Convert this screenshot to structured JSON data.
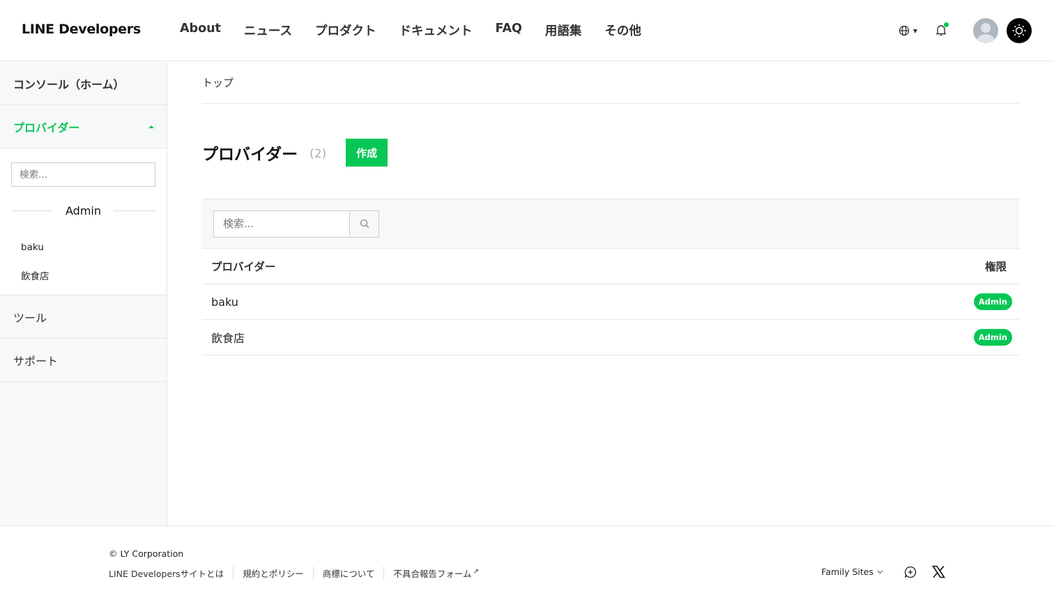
{
  "header": {
    "logo": "LINE Developers",
    "nav": [
      "About",
      "ニュース",
      "プロダクト",
      "ドキュメント",
      "FAQ",
      "用語集",
      "その他"
    ],
    "icons": [
      "globe-icon",
      "bell-icon",
      "avatar",
      "sun-icon"
    ]
  },
  "sidebar": {
    "console": "コンソール（ホーム）",
    "providers": "プロバイダー",
    "search_placeholder": "検索...",
    "group_label": "Admin",
    "provider_items": [
      "baku",
      "飲食店"
    ],
    "tools": "ツール",
    "support": "サポート"
  },
  "main": {
    "breadcrumb": "トップ",
    "title": "プロバイダー",
    "count": "(2)",
    "create_label": "作成",
    "search_placeholder": "検索...",
    "table": {
      "headers": [
        "プロバイダー",
        "権限"
      ],
      "rows": [
        {
          "name": "baku",
          "role": "Admin"
        },
        {
          "name": "飲食店",
          "role": "Admin"
        }
      ]
    }
  },
  "footer": {
    "copyright": "© LY Corporation",
    "links": [
      "LINE Developersサイトとは",
      "規約とポリシー",
      "商標について",
      "不具合報告フォーム"
    ],
    "family_sites": "Family Sites"
  },
  "colors": {
    "accent": "#06c755",
    "sidebar_bg": "#f7f8f9"
  }
}
